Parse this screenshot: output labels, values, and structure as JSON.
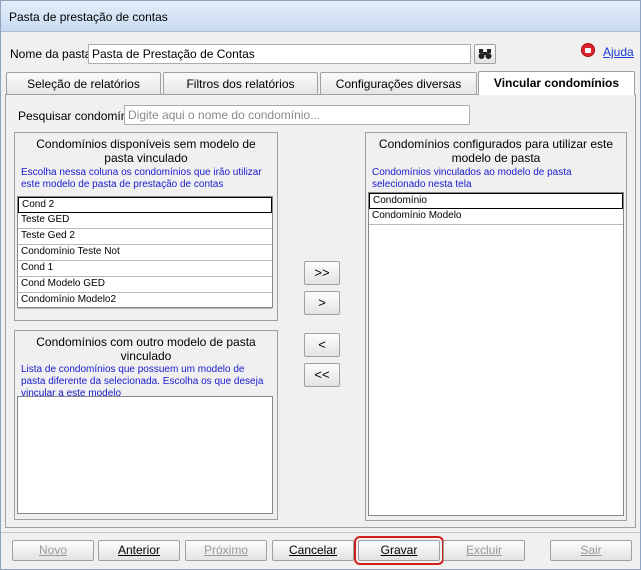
{
  "window": {
    "title": "Pasta de prestação de contas"
  },
  "header": {
    "folder_label": "Nome da pasta:",
    "folder_value": "Pasta de Prestação de Contas",
    "help_label": "Ajuda"
  },
  "tabs": [
    {
      "label": "Seleção de relatórios"
    },
    {
      "label": "Filtros dos relatórios"
    },
    {
      "label": "Configurações diversas"
    },
    {
      "label": "Vincular condomínios"
    }
  ],
  "search": {
    "label": "Pesquisar condomínio:",
    "placeholder": "Digite aqui o nome do condomínio..."
  },
  "available": {
    "title": "Condomínios disponíveis sem modelo de pasta vinculado",
    "description": "Escolha nessa coluna os condomínios que irão utilizar este modelo de pasta de prestação de contas",
    "items": [
      "Cond 2",
      "Teste GED",
      "Teste Ged 2",
      "Condomínio Teste Not",
      "Cond 1",
      "Cond Modelo GED",
      "Condomínio Modelo2"
    ]
  },
  "other": {
    "title": "Condomínios com outro modelo de pasta vinculado",
    "description": "Lista de condomínios que possuem um modelo de pasta diferente da selecionada. Escolha os que deseja vincular a este modelo"
  },
  "configured": {
    "title": "Condomínios configurados para utilizar este modelo de pasta",
    "description": "Condomínios vinculados ao modelo de pasta selecionado nesta tela",
    "items": [
      "Condomínio",
      "Condomínio Modelo"
    ]
  },
  "transfer": {
    "add_all": ">>",
    "add_one": ">",
    "remove_one": "<",
    "remove_all": "<<"
  },
  "footer": {
    "novo": "Novo",
    "anterior": "Anterior",
    "proximo": "Próximo",
    "cancelar": "Cancelar",
    "gravar": "Gravar",
    "excluir": "Excluir",
    "sair": "Sair"
  }
}
